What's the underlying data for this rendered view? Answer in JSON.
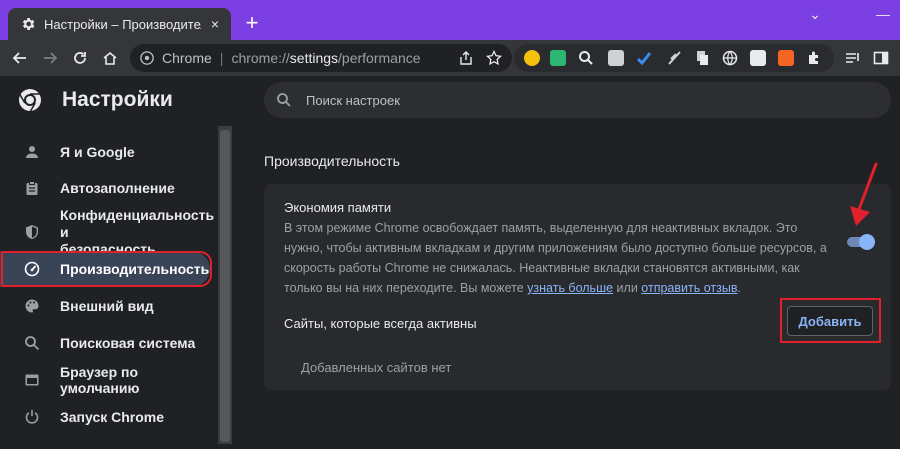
{
  "browser": {
    "tab": {
      "title": "Настройки – Производительнос",
      "close": "×"
    },
    "new_tab": "+",
    "window_controls": {
      "collapse": "⌄",
      "minimize": "—"
    },
    "omnibox": {
      "site_label": "Chrome",
      "separator": "|",
      "url_prefix": "chrome://",
      "url_host": "settings",
      "url_path": "/performance"
    },
    "accent_color": "#7b3fe4"
  },
  "header": {
    "title": "Настройки",
    "search_placeholder": "Поиск настроек"
  },
  "sidebar": {
    "items": [
      {
        "label": "Я и Google",
        "icon": "person-icon"
      },
      {
        "label": "Автозаполнение",
        "icon": "clipboard-icon"
      },
      {
        "label_line1": "Конфиденциальность и",
        "label_line2": "безопасность",
        "icon": "shield-icon"
      },
      {
        "label": "Производительность",
        "icon": "speedometer-icon",
        "active": true
      },
      {
        "label": "Внешний вид",
        "icon": "palette-icon"
      },
      {
        "label": "Поисковая система",
        "icon": "search-icon"
      },
      {
        "label": "Браузер по умолчанию",
        "icon": "browser-icon"
      },
      {
        "label": "Запуск Chrome",
        "icon": "power-icon"
      }
    ]
  },
  "main": {
    "section_title": "Производительность",
    "memory_saver": {
      "title": "Экономия памяти",
      "description": "В этом режиме Chrome освобождает память, выделенную для неактивных вкладок. Это нужно, чтобы активным вкладкам и другим приложениям было доступно больше ресурсов, а скорость работы Chrome не снижалась. Неактивные вкладки становятся активными, как только вы на них переходите. Вы можете",
      "learn_more": "узнать больше",
      "or": "или",
      "feedback": "отправить отзыв",
      "period": ".",
      "enabled": true
    },
    "always_active": {
      "label": "Сайты, которые всегда активны",
      "add_button": "Добавить",
      "empty_text": "Добавленных сайтов нет"
    }
  }
}
